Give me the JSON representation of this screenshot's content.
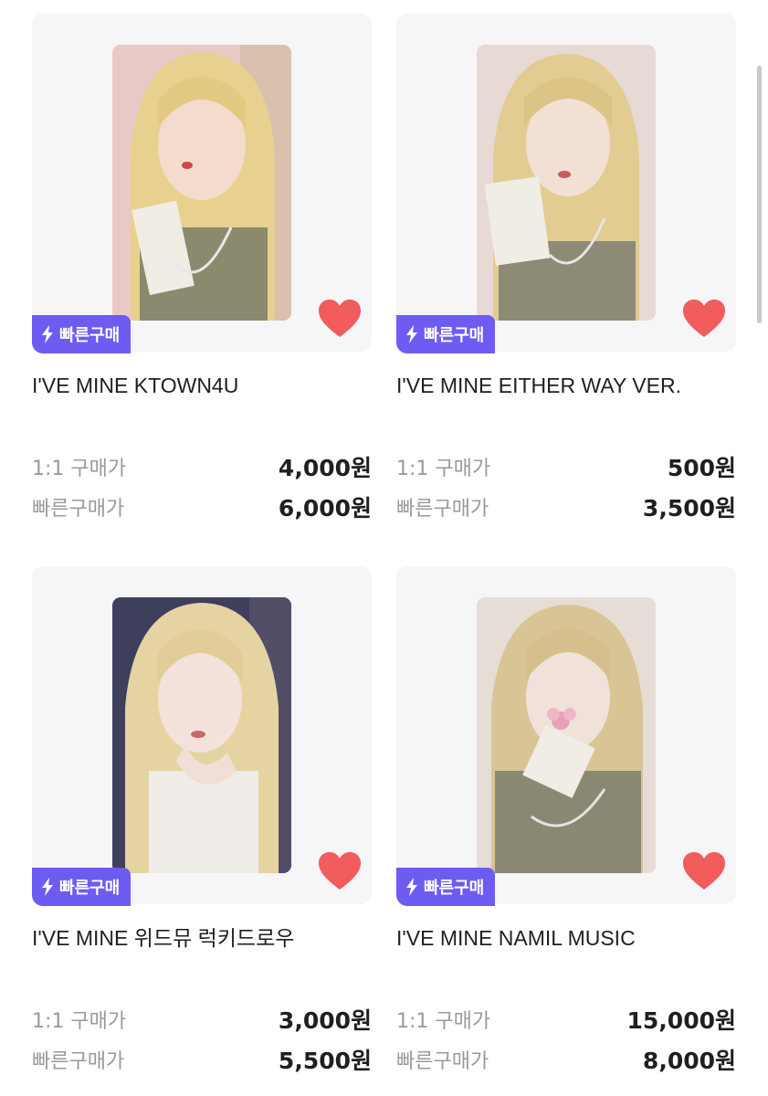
{
  "badge_label": "빠른구매",
  "accent_color": "#6d5cf2",
  "heart_color": "#f25c5c",
  "products": [
    {
      "title": "I'VE MINE KTOWN4U",
      "image": "photocard-blonde-finger-lip-pose",
      "badge": "빠른구매",
      "liked": true,
      "price_1to1_label": "1:1 구매가",
      "price_1to1": "4,000원",
      "price_quick_label": "빠른구매가",
      "price_quick": "6,000원"
    },
    {
      "title": "I'VE MINE EITHER WAY  VER.",
      "image": "photocard-blonde-chin-rest-pose",
      "badge": "빠른구매",
      "liked": true,
      "price_1to1_label": "1:1 구매가",
      "price_1to1": "500원",
      "price_quick_label": "빠른구매가",
      "price_quick": "3,500원"
    },
    {
      "title": "I'VE MINE 위드뮤 럭키드로우",
      "image": "photocard-blonde-hand-cheek-pose",
      "badge": "빠른구매",
      "liked": true,
      "price_1to1_label": "1:1 구매가",
      "price_1to1": "3,000원",
      "price_quick_label": "빠른구매가",
      "price_quick": "5,500원"
    },
    {
      "title": "I'VE MINE NAMIL MUSIC",
      "image": "photocard-blonde-flower-pose",
      "badge": "빠른구매",
      "liked": true,
      "price_1to1_label": "1:1 구매가",
      "price_1to1": "15,000원",
      "price_quick_label": "빠른구매가",
      "price_quick": "8,000원"
    }
  ]
}
